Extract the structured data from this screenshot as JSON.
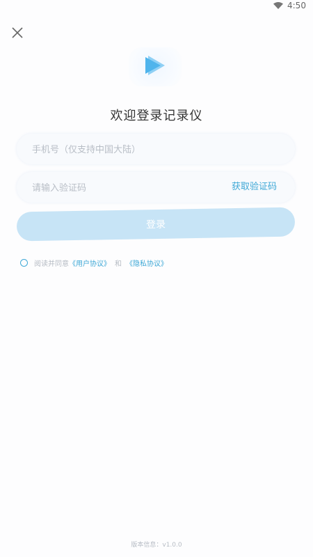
{
  "status_bar": {
    "time": "4:50",
    "wifi_icon": "wifi-icon"
  },
  "header": {
    "close_icon": "close-icon"
  },
  "logo": {
    "icon": "play-logo-icon",
    "color": "#4fb4ec"
  },
  "title": "欢迎登录记录仪",
  "form": {
    "phone_placeholder": "手机号（仅支持中国大陆）",
    "phone_value": "",
    "code_placeholder": "请输入验证码",
    "code_value": "",
    "get_code_label": "获取验证码",
    "login_label": "登录"
  },
  "agreement": {
    "prefix": "阅读并同意",
    "user_agreement": "《用户协议》",
    "and": "和",
    "privacy_policy": "《隐私协议》",
    "checked": false
  },
  "footer": {
    "version": "版本信息：v1.0.0"
  },
  "colors": {
    "accent": "#3ea8d6",
    "button_bg": "#c7e4f6",
    "background": "#fdfdfe"
  }
}
